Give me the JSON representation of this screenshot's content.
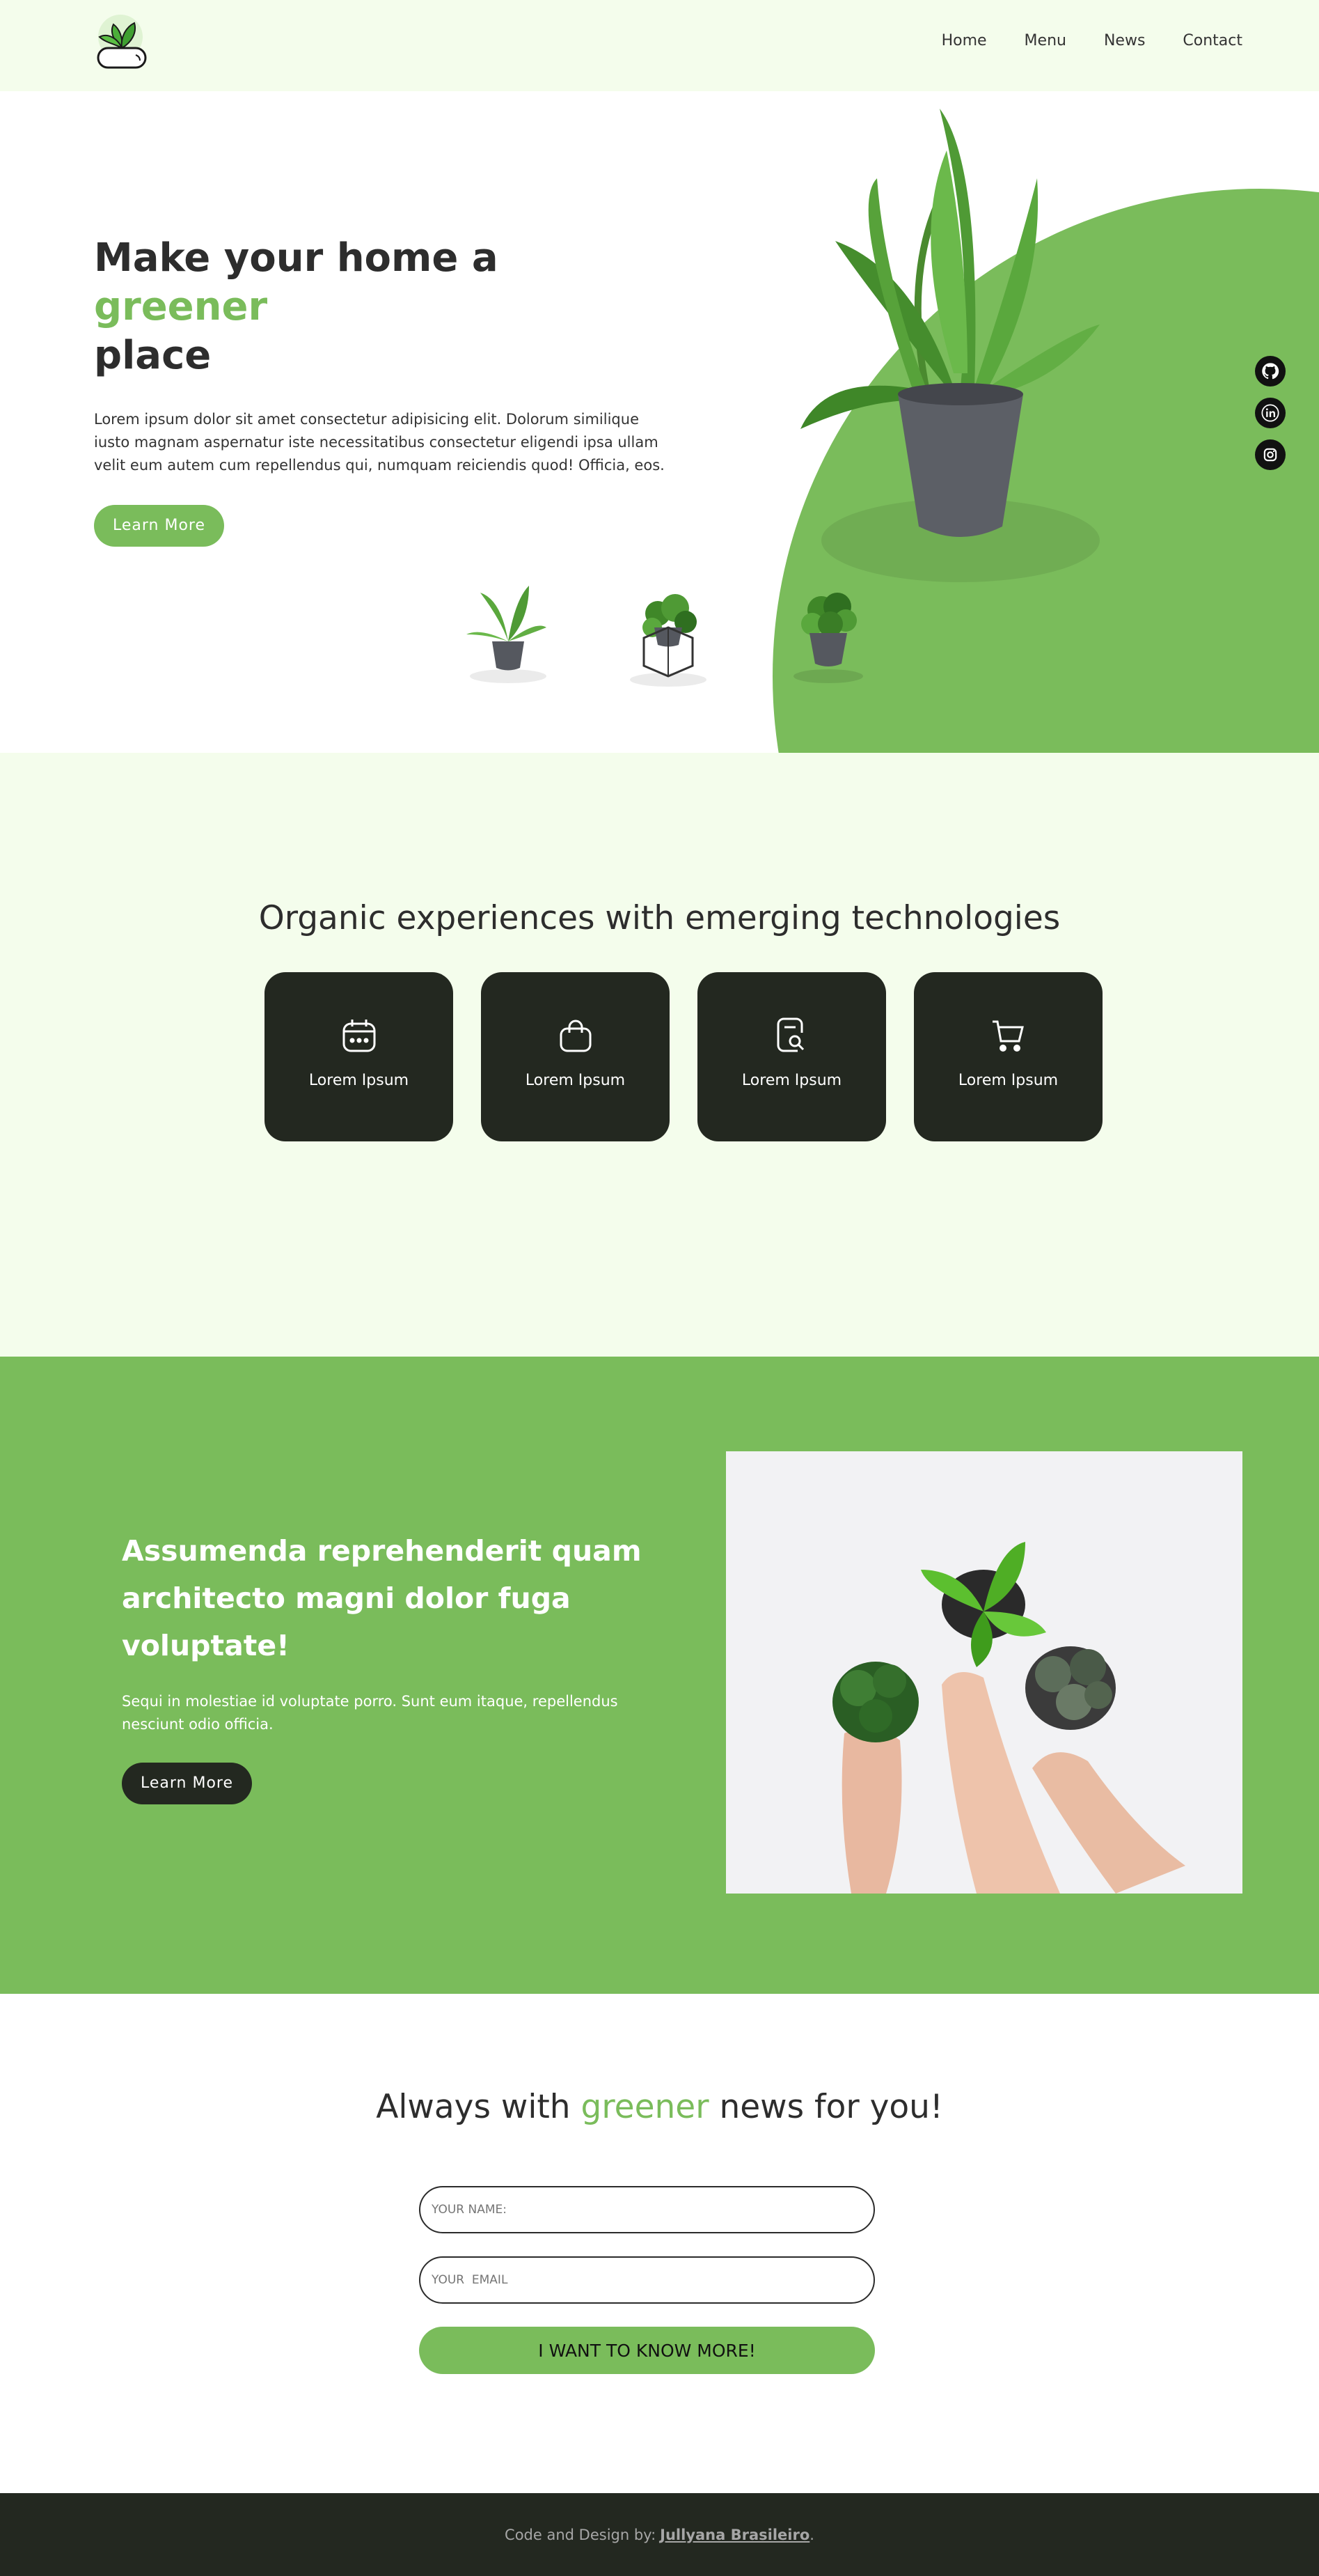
{
  "nav": {
    "logo_name": "plant-pot-logo",
    "links": [
      "Home",
      "Menu",
      "News",
      "Contact"
    ]
  },
  "hero": {
    "title_start": "Make your home a ",
    "title_accent": "greener",
    "title_end": "place",
    "description": "Lorem ipsum dolor sit amet consectetur adipisicing elit. Dolorum similique iusto magnam aspernatur iste necessitatibus consectetur eligendi ipsa ullam velit eum autem cum repellendus qui, numquam reiciendis quod! Officia, eos.",
    "button": "Learn More",
    "social": [
      "github-icon",
      "linkedin-icon",
      "instagram-icon"
    ]
  },
  "features": {
    "title": "Organic experiences with emerging technologies",
    "cards": [
      {
        "icon": "calendar-icon",
        "label": "Lorem Ipsum"
      },
      {
        "icon": "shopping-bag-icon",
        "label": "Lorem Ipsum"
      },
      {
        "icon": "document-search-icon",
        "label": "Lorem Ipsum"
      },
      {
        "icon": "cart-icon",
        "label": "Lorem Ipsum"
      }
    ]
  },
  "promo": {
    "title": "Assumenda reprehenderit quam architecto magni dolor fuga voluptate!",
    "description": "Sequi in molestiae id voluptate porro. Sunt eum itaque, repellendus nesciunt odio officia.",
    "button": "Learn More"
  },
  "newsletter": {
    "title_start": "Always with ",
    "title_accent": "greener",
    "title_end": " news for you!",
    "name_placeholder": "YOUR NAME:",
    "email_placeholder": "YOUR  EMAIL",
    "submit": "I WANT TO KNOW MORE!"
  },
  "footer": {
    "text": "Code and Design by:",
    "author": "Jullyana Brasileiro",
    "suffix": "."
  },
  "colors": {
    "brand_green": "#7abc5b",
    "dark": "#232820",
    "light_green_bg": "#f4fdec"
  }
}
